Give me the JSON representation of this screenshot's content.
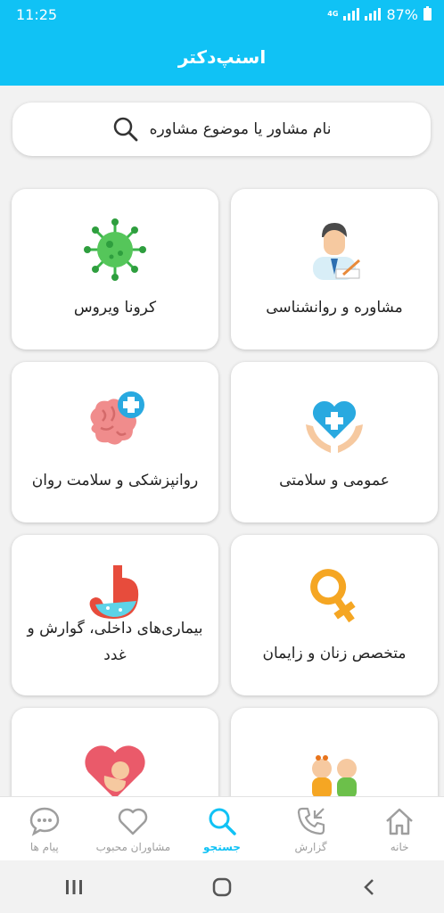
{
  "status": {
    "time": "11:25",
    "network": "4G",
    "battery": "87%"
  },
  "app": {
    "title": "اسنپ‌دکتر"
  },
  "search": {
    "placeholder": "نام مشاور یا موضوع مشاوره"
  },
  "categories": [
    {
      "label": "مشاوره و روانشناسی",
      "icon": "counselor-icon"
    },
    {
      "label": "کرونا ویروس",
      "icon": "virus-icon"
    },
    {
      "label": "عمومی و سلامتی",
      "icon": "heart-hands-icon"
    },
    {
      "label": "روانپزشکی و سلامت روان",
      "icon": "brain-icon"
    },
    {
      "label": "متخصص زنان و زایمان",
      "icon": "female-symbol-icon"
    },
    {
      "label": "بیماری‌های داخلی، گوارش و غدد",
      "icon": "stomach-icon"
    },
    {
      "label": "",
      "icon": "babies-icon"
    },
    {
      "label": "",
      "icon": "fetus-heart-icon"
    }
  ],
  "nav": {
    "home": "خانه",
    "reports": "گزارش",
    "search": "جستجو",
    "favorites": "مشاوران محبوب",
    "messages": "پیام ها"
  },
  "colors": {
    "primary": "#10c2f5",
    "inactive": "#9e9e9e"
  }
}
